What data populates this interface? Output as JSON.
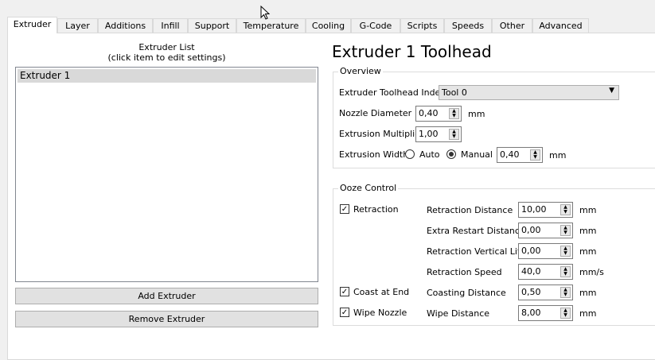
{
  "tabs": [
    "Extruder",
    "Layer",
    "Additions",
    "Infill",
    "Support",
    "Temperature",
    "Cooling",
    "G-Code",
    "Scripts",
    "Speeds",
    "Other",
    "Advanced"
  ],
  "extruder_list": {
    "title": "Extruder List",
    "subtitle": "(click item to edit settings)",
    "items": [
      "Extruder 1"
    ],
    "add_label": "Add Extruder",
    "remove_label": "Remove Extruder"
  },
  "toolhead": {
    "title": "Extruder 1 Toolhead"
  },
  "overview": {
    "title": "Overview",
    "toolhead_index_label": "Extruder Toolhead Index",
    "toolhead_index_value": "Tool 0",
    "nozzle_label": "Nozzle Diameter",
    "nozzle_value": "0,40",
    "nozzle_unit": "mm",
    "multiplier_label": "Extrusion Multiplier",
    "multiplier_value": "1,00",
    "width_label": "Extrusion Width",
    "auto_label": "Auto",
    "manual_label": "Manual",
    "width_value": "0,40",
    "width_unit": "mm",
    "width_mode": "Manual"
  },
  "ooze": {
    "title": "Ooze Control",
    "retraction_label": "Retraction",
    "retraction_checked": true,
    "coast_label": "Coast at End",
    "coast_checked": true,
    "wipe_label": "Wipe Nozzle",
    "wipe_checked": true,
    "fields": [
      {
        "label": "Retraction Distance",
        "value": "10,00",
        "unit": "mm"
      },
      {
        "label": "Extra Restart Distance",
        "value": "0,00",
        "unit": "mm"
      },
      {
        "label": "Retraction Vertical Lift",
        "value": "0,00",
        "unit": "mm"
      },
      {
        "label": "Retraction Speed",
        "value": "40,0",
        "unit": "mm/s"
      },
      {
        "label": "Coasting Distance",
        "value": "0,50",
        "unit": "mm"
      },
      {
        "label": "Wipe Distance",
        "value": "8,00",
        "unit": "mm"
      }
    ]
  }
}
